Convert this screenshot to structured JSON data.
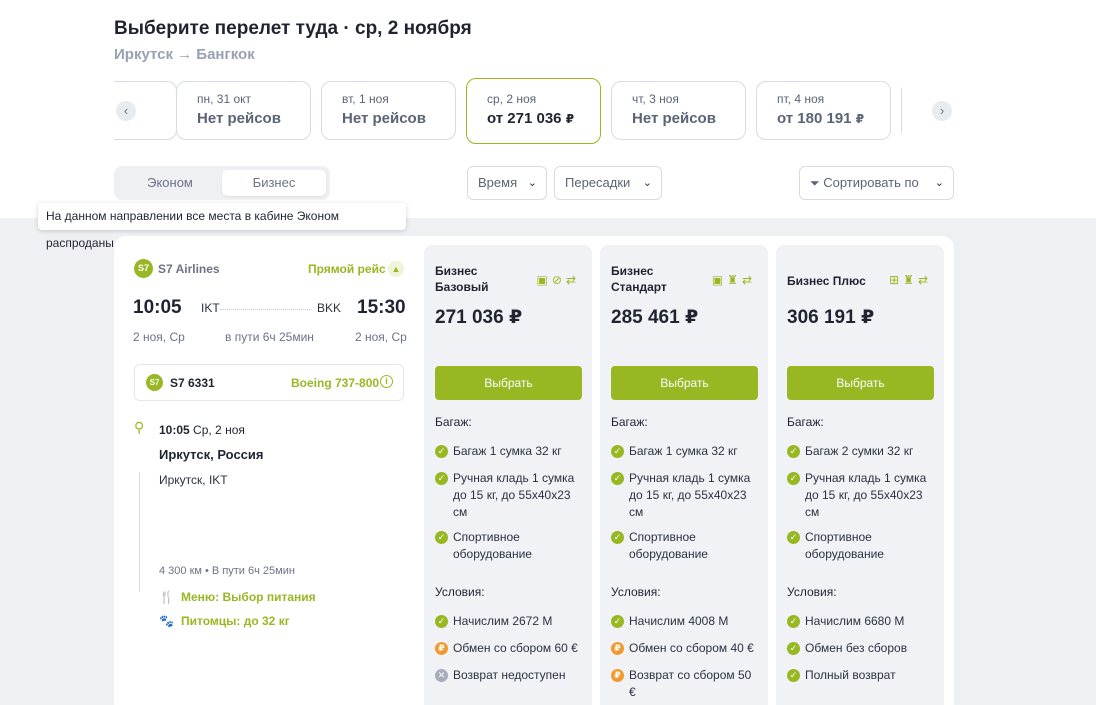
{
  "header": {
    "title": "Выберите перелет туда · ср, 2 ноября",
    "route": "Иркутск → Бангкок"
  },
  "dates": [
    {
      "date": "пн, 31 окт",
      "price": "Нет рейсов",
      "rub": ""
    },
    {
      "date": "вт, 1 ноя",
      "price": "Нет рейсов",
      "rub": ""
    },
    {
      "date": "ср, 2 ноя",
      "price": "от 271 036",
      "rub": "₽"
    },
    {
      "date": "чт, 3 ноя",
      "price": "Нет рейсов",
      "rub": ""
    },
    {
      "date": "пт, 4 ноя",
      "price": "от 180 191",
      "rub": "₽"
    }
  ],
  "cabin": {
    "econom": "Эконом",
    "business": "Бизнес"
  },
  "filters": {
    "time": "Время",
    "transfers": "Пересадки",
    "sort": "Сортировать по"
  },
  "tooltip": "На данном направлении все места в кабине Эконом распроданы",
  "flight": {
    "airline": "S7 Airlines",
    "logo_text": "S7",
    "direct": "Прямой рейс",
    "dep_time": "10:05",
    "arr_time": "15:30",
    "dep_code": "IKT",
    "arr_code": "BKK",
    "dep_date": "2 ноя, Ср",
    "arr_date": "2 ноя, Ср",
    "duration": "в пути 6ч 25мин",
    "number": "S7 6331",
    "aircraft": "Boeing 737-800",
    "segment": {
      "time": "10:05",
      "date": "Ср, 2 ноя",
      "city": "Иркутск, Россия",
      "airport": "Иркутск, IKT",
      "distance": "4 300 км • В пути 6ч 25мин",
      "meal": "Меню: Выбор питания",
      "pets": "Питомцы: до 32 кг"
    }
  },
  "fares": [
    {
      "name": "Бизнес Базовый",
      "price": "271 036 ₽",
      "button": "Выбрать",
      "baggage_title": "Багаж:",
      "baggage": [
        "Багаж 1 сумка 32 кг",
        "Ручная кладь 1 сумка до 15 кг, до 55х40х23 см",
        "Спортивное оборудование"
      ],
      "conditions_title": "Условия:",
      "conditions": [
        {
          "text": "Начислим 2672 M",
          "status": "ok"
        },
        {
          "text": "Обмен со сбором 60 €",
          "status": "fee"
        },
        {
          "text": "Возврат недоступен",
          "status": "no"
        }
      ]
    },
    {
      "name": "Бизнес Стандарт",
      "price": "285 461 ₽",
      "button": "Выбрать",
      "baggage_title": "Багаж:",
      "baggage": [
        "Багаж 1 сумка 32 кг",
        "Ручная кладь 1 сумка до 15 кг, до 55х40х23 см",
        "Спортивное оборудование"
      ],
      "conditions_title": "Условия:",
      "conditions": [
        {
          "text": "Начислим 4008 M",
          "status": "ok"
        },
        {
          "text": "Обмен со сбором 40 €",
          "status": "fee"
        },
        {
          "text": "Возврат со сбором 50 €",
          "status": "fee"
        }
      ]
    },
    {
      "name": "Бизнес Плюс",
      "price": "306 191 ₽",
      "button": "Выбрать",
      "baggage_title": "Багаж:",
      "baggage": [
        "Багаж 2 сумки 32 кг",
        "Ручная кладь 1 сумка до 15 кг, до 55х40х23 см",
        "Спортивное оборудование"
      ],
      "conditions_title": "Условия:",
      "conditions": [
        {
          "text": "Начислим 6680 M",
          "status": "ok"
        },
        {
          "text": "Обмен без сборов",
          "status": "ok"
        },
        {
          "text": "Полный возврат",
          "status": "ok"
        }
      ]
    }
  ]
}
